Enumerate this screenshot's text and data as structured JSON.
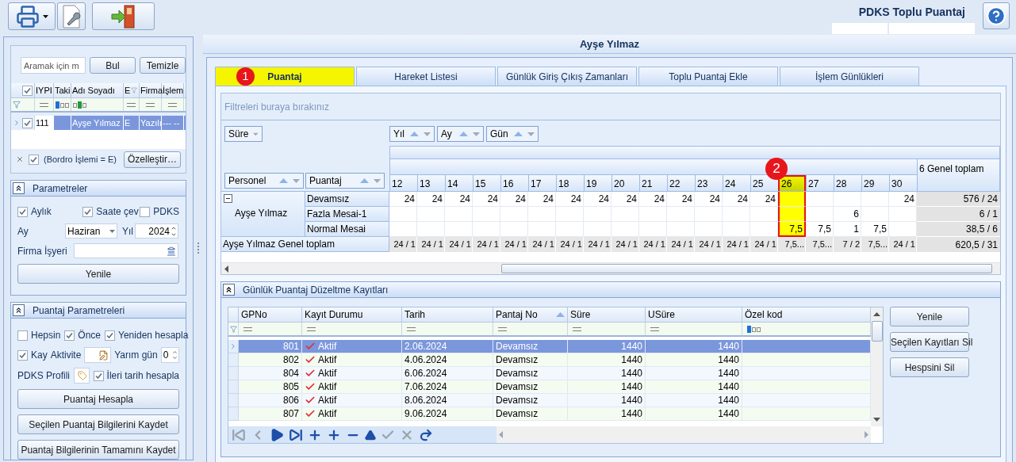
{
  "toolbar": {
    "buttons": [
      {
        "kind": "print",
        "has_menu": true
      },
      {
        "kind": "settings",
        "has_menu": false
      },
      {
        "kind": "exit",
        "has_menu": false
      }
    ],
    "title": "PDKS Toplu Puantaj"
  },
  "left": {
    "search": {
      "placeholder": "Aramak için m",
      "buttons": [
        "Bul",
        "Temizle"
      ]
    },
    "grid": {
      "header_checked": true,
      "columns": [
        {
          "label": "IYPI",
          "filter": {
            "kind": "equals"
          },
          "filtered": false
        },
        {
          "label": "Taki",
          "filter": {
            "kind": "begins"
          },
          "filtered": false
        },
        {
          "label": "Adı Soyadı",
          "filter": {
            "kind": "contains"
          },
          "filtered": false
        },
        {
          "label": "E",
          "filter": {
            "kind": "equals"
          },
          "filtered": true
        },
        {
          "label": "Firma",
          "filter": {
            "kind": "equals"
          },
          "filtered": false
        },
        {
          "label": "İşlem",
          "filter": {
            "kind": "equals"
          },
          "filtered": false
        }
      ],
      "rows": [
        {
          "selected": true,
          "checked": true,
          "cells": [
            {
              "kind": "value",
              "text": "111"
            },
            {
              "kind": "blank"
            },
            {
              "kind": "value",
              "text": "Ayşe Yılmaz"
            },
            {
              "kind": "value",
              "text": "E"
            },
            {
              "kind": "value",
              "text": "Yazılı"
            },
            {
              "kind": "value",
              "text": "--- --"
            }
          ]
        }
      ]
    },
    "filter": {
      "checked": true,
      "text": "(Bordro İşlemi = E)",
      "button": "Özelleştir…"
    }
  },
  "parameters": {
    "title": "Parametreler",
    "expanded": true,
    "checkboxes": [
      {
        "label": "Aylık",
        "checked": true
      },
      {
        "label": "Saate çev",
        "checked": true
      },
      {
        "label": "PDKS",
        "checked": false
      }
    ],
    "month": {
      "label": "Ay",
      "value": "Haziran"
    },
    "year": {
      "label": "Yıl",
      "value": "2024"
    },
    "company": {
      "label": "Firma İşyeri"
    },
    "button": "Yenile"
  },
  "calc": {
    "title": "Puantaj Parametreleri",
    "expanded": true,
    "options": [
      {
        "label": "Hepsin",
        "checked": false
      },
      {
        "label": "Önce",
        "checked": true
      },
      {
        "label": "Yeniden hesapla",
        "checked": true
      }
    ],
    "kay": {
      "label": "Kay",
      "checked": true
    },
    "activity": {
      "label": "Aktivite"
    },
    "half_day": {
      "label": "Yarım gün",
      "value": "0"
    },
    "profile": {
      "label": "PDKS Profili"
    },
    "forward": {
      "label": "İleri tarih hesapla",
      "checked": true
    },
    "buttons": [
      "Puantaj Hesapla",
      "Seçilen Puantaj Bilgilerini Kaydet",
      "Puantaj Bilgilerinin Tamamını Kaydet"
    ]
  },
  "employee": "Ayşe Yılmaz",
  "tabs": [
    {
      "label": "Puantaj",
      "selected": true,
      "highlighted": true,
      "marker": "1"
    },
    {
      "label": "Hareket Listesi",
      "selected": false,
      "highlighted": false
    },
    {
      "label": "Günlük Giriş Çıkış Zamanları",
      "selected": false,
      "highlighted": false
    },
    {
      "label": "Toplu Puantaj Ekle",
      "selected": false,
      "highlighted": false
    },
    {
      "label": "İşlem Günlükleri",
      "selected": false,
      "highlighted": false
    }
  ],
  "pivot": {
    "filter_hint": "Filtreleri buraya bırakınız",
    "data_fields": [
      {
        "label": "Süre",
        "sortable": false
      }
    ],
    "column_fields": [
      {
        "label": "Yıl",
        "sortable": true
      },
      {
        "label": "Ay",
        "sortable": true
      },
      {
        "label": "Gün",
        "sortable": true
      }
    ],
    "row_fields": [
      {
        "label": "Personel",
        "sortable": true
      },
      {
        "label": "Puantaj",
        "sortable": true
      }
    ],
    "days": [
      {
        "label": "12",
        "highlighted": false
      },
      {
        "label": "13",
        "highlighted": false
      },
      {
        "label": "14",
        "highlighted": false
      },
      {
        "label": "15",
        "highlighted": false
      },
      {
        "label": "16",
        "highlighted": false
      },
      {
        "label": "17",
        "highlighted": false
      },
      {
        "label": "18",
        "highlighted": false
      },
      {
        "label": "19",
        "highlighted": false
      },
      {
        "label": "20",
        "highlighted": false
      },
      {
        "label": "21",
        "highlighted": false
      },
      {
        "label": "22",
        "highlighted": false
      },
      {
        "label": "23",
        "highlighted": false
      },
      {
        "label": "24",
        "highlighted": false
      },
      {
        "label": "25",
        "highlighted": false
      },
      {
        "label": "26",
        "highlighted": true,
        "marker": "2"
      },
      {
        "label": "27",
        "highlighted": false
      },
      {
        "label": "28",
        "highlighted": false
      },
      {
        "label": "29",
        "highlighted": false
      },
      {
        "label": "30",
        "highlighted": false
      }
    ],
    "grand_total_label": "6 Genel toplam",
    "person": {
      "name": "Ayşe Yılmaz",
      "expanded": true
    },
    "rows": [
      {
        "label": "Devamsız",
        "values": [
          {
            "kind": "value",
            "text": "24"
          },
          {
            "kind": "value",
            "text": "24"
          },
          {
            "kind": "value",
            "text": "24"
          },
          {
            "kind": "value",
            "text": "24"
          },
          {
            "kind": "value",
            "text": "24"
          },
          {
            "kind": "value",
            "text": "24"
          },
          {
            "kind": "value",
            "text": "24"
          },
          {
            "kind": "value",
            "text": "24"
          },
          {
            "kind": "value",
            "text": "24"
          },
          {
            "kind": "value",
            "text": "24"
          },
          {
            "kind": "value",
            "text": "24"
          },
          {
            "kind": "value",
            "text": "24"
          },
          {
            "kind": "value",
            "text": "24"
          },
          {
            "kind": "value",
            "text": "24"
          },
          {
            "kind": "blank"
          },
          {
            "kind": "blank"
          },
          {
            "kind": "blank"
          },
          {
            "kind": "blank"
          },
          {
            "kind": "value",
            "text": "24"
          }
        ],
        "total": "576 / 24"
      },
      {
        "label": "Fazla Mesai-1",
        "values": [
          {
            "kind": "blank"
          },
          {
            "kind": "blank"
          },
          {
            "kind": "blank"
          },
          {
            "kind": "blank"
          },
          {
            "kind": "blank"
          },
          {
            "kind": "blank"
          },
          {
            "kind": "blank"
          },
          {
            "kind": "blank"
          },
          {
            "kind": "blank"
          },
          {
            "kind": "blank"
          },
          {
            "kind": "blank"
          },
          {
            "kind": "blank"
          },
          {
            "kind": "blank"
          },
          {
            "kind": "blank"
          },
          {
            "kind": "blank"
          },
          {
            "kind": "blank"
          },
          {
            "kind": "value",
            "text": "6"
          },
          {
            "kind": "blank"
          },
          {
            "kind": "blank"
          }
        ],
        "total": "6 / 1"
      },
      {
        "label": "Normal Mesai",
        "values": [
          {
            "kind": "blank"
          },
          {
            "kind": "blank"
          },
          {
            "kind": "blank"
          },
          {
            "kind": "blank"
          },
          {
            "kind": "blank"
          },
          {
            "kind": "blank"
          },
          {
            "kind": "blank"
          },
          {
            "kind": "blank"
          },
          {
            "kind": "blank"
          },
          {
            "kind": "blank"
          },
          {
            "kind": "blank"
          },
          {
            "kind": "blank"
          },
          {
            "kind": "blank"
          },
          {
            "kind": "blank"
          },
          {
            "kind": "value",
            "text": "7,5"
          },
          {
            "kind": "value",
            "text": "7,5"
          },
          {
            "kind": "value",
            "text": "1"
          },
          {
            "kind": "value",
            "text": "7,5"
          },
          {
            "kind": "blank"
          }
        ],
        "total": "38,5 / 6"
      }
    ],
    "person_total": {
      "label": "Ayşe Yılmaz Genel toplam",
      "values": [
        "24 / 1",
        "24 / 1",
        "24 / 1",
        "24 / 1",
        "24 / 1",
        "24 / 1",
        "24 / 1",
        "24 / 1",
        "24 / 1",
        "24 / 1",
        "24 / 1",
        "24 / 1",
        "24 / 1",
        "24 / 1",
        "7,5...",
        "7,5...",
        "7 / 2",
        "7,5...",
        "24 / 1"
      ],
      "total": "620,5 / 31"
    }
  },
  "corrections": {
    "title": "Günlük Puantaj Düzeltme Kayıtları",
    "expanded": true,
    "columns": [
      {
        "label": "GPNo",
        "kind": "number",
        "filter": {
          "kind": "equals"
        },
        "sorted": false
      },
      {
        "label": "Kayıt Durumu",
        "kind": "status",
        "filter": {
          "kind": "equals"
        },
        "sorted": false
      },
      {
        "label": "Tarih",
        "kind": "text",
        "filter": {
          "kind": "equals"
        },
        "sorted": false
      },
      {
        "label": "Pantaj No",
        "kind": "text",
        "filter": {
          "kind": "equals"
        },
        "sorted": true
      },
      {
        "label": "Süre",
        "kind": "number",
        "filter": {
          "kind": "equals"
        },
        "sorted": false
      },
      {
        "label": "USüre",
        "kind": "number",
        "filter": {
          "kind": "equals"
        },
        "sorted": false
      },
      {
        "label": "Özel kod",
        "kind": "text",
        "filter": {
          "kind": "begins"
        },
        "sorted": false
      }
    ],
    "rows": [
      {
        "selected": true,
        "cells": [
          {
            "kind": "value",
            "text": "801"
          },
          {
            "kind": "value",
            "text": "Aktif"
          },
          {
            "kind": "value",
            "text": "2.06.2024"
          },
          {
            "kind": "value",
            "text": "Devamsız"
          },
          {
            "kind": "value",
            "text": "1440"
          },
          {
            "kind": "value",
            "text": "1440"
          },
          {
            "kind": "blank"
          }
        ]
      },
      {
        "selected": false,
        "cells": [
          {
            "kind": "value",
            "text": "802"
          },
          {
            "kind": "value",
            "text": "Aktif"
          },
          {
            "kind": "value",
            "text": "4.06.2024"
          },
          {
            "kind": "value",
            "text": "Devamsız"
          },
          {
            "kind": "value",
            "text": "1440"
          },
          {
            "kind": "value",
            "text": "1440"
          },
          {
            "kind": "blank"
          }
        ]
      },
      {
        "selected": false,
        "cells": [
          {
            "kind": "value",
            "text": "804"
          },
          {
            "kind": "value",
            "text": "Aktif"
          },
          {
            "kind": "value",
            "text": "6.06.2024"
          },
          {
            "kind": "value",
            "text": "Devamsız"
          },
          {
            "kind": "value",
            "text": "1440"
          },
          {
            "kind": "value",
            "text": "1440"
          },
          {
            "kind": "blank"
          }
        ]
      },
      {
        "selected": false,
        "cells": [
          {
            "kind": "value",
            "text": "805"
          },
          {
            "kind": "value",
            "text": "Aktif"
          },
          {
            "kind": "value",
            "text": "7.06.2024"
          },
          {
            "kind": "value",
            "text": "Devamsız"
          },
          {
            "kind": "value",
            "text": "1440"
          },
          {
            "kind": "value",
            "text": "1440"
          },
          {
            "kind": "blank"
          }
        ]
      },
      {
        "selected": false,
        "cells": [
          {
            "kind": "value",
            "text": "806"
          },
          {
            "kind": "value",
            "text": "Aktif"
          },
          {
            "kind": "value",
            "text": "8.06.2024"
          },
          {
            "kind": "value",
            "text": "Devamsız"
          },
          {
            "kind": "value",
            "text": "1440"
          },
          {
            "kind": "value",
            "text": "1440"
          },
          {
            "kind": "blank"
          }
        ]
      },
      {
        "selected": false,
        "cells": [
          {
            "kind": "value",
            "text": "807"
          },
          {
            "kind": "value",
            "text": "Aktif"
          },
          {
            "kind": "value",
            "text": "9.06.2024"
          },
          {
            "kind": "value",
            "text": "Devamsız"
          },
          {
            "kind": "value",
            "text": "1440"
          },
          {
            "kind": "value",
            "text": "1440"
          },
          {
            "kind": "blank"
          }
        ]
      }
    ],
    "navigator": [
      {
        "kind": "first",
        "disabled": true
      },
      {
        "kind": "prev",
        "disabled": true
      },
      {
        "kind": "next",
        "disabled": false
      },
      {
        "kind": "last",
        "disabled": false
      },
      {
        "kind": "add",
        "disabled": false
      },
      {
        "kind": "insert",
        "disabled": false
      },
      {
        "kind": "delete",
        "disabled": false
      },
      {
        "kind": "up",
        "disabled": false
      },
      {
        "kind": "save",
        "disabled": true
      },
      {
        "kind": "cancel",
        "disabled": true
      },
      {
        "kind": "refresh",
        "disabled": false
      }
    ],
    "buttons": [
      "Yenile",
      "Seçilen Kayıtları Sil",
      "Hespsini Sil"
    ]
  }
}
